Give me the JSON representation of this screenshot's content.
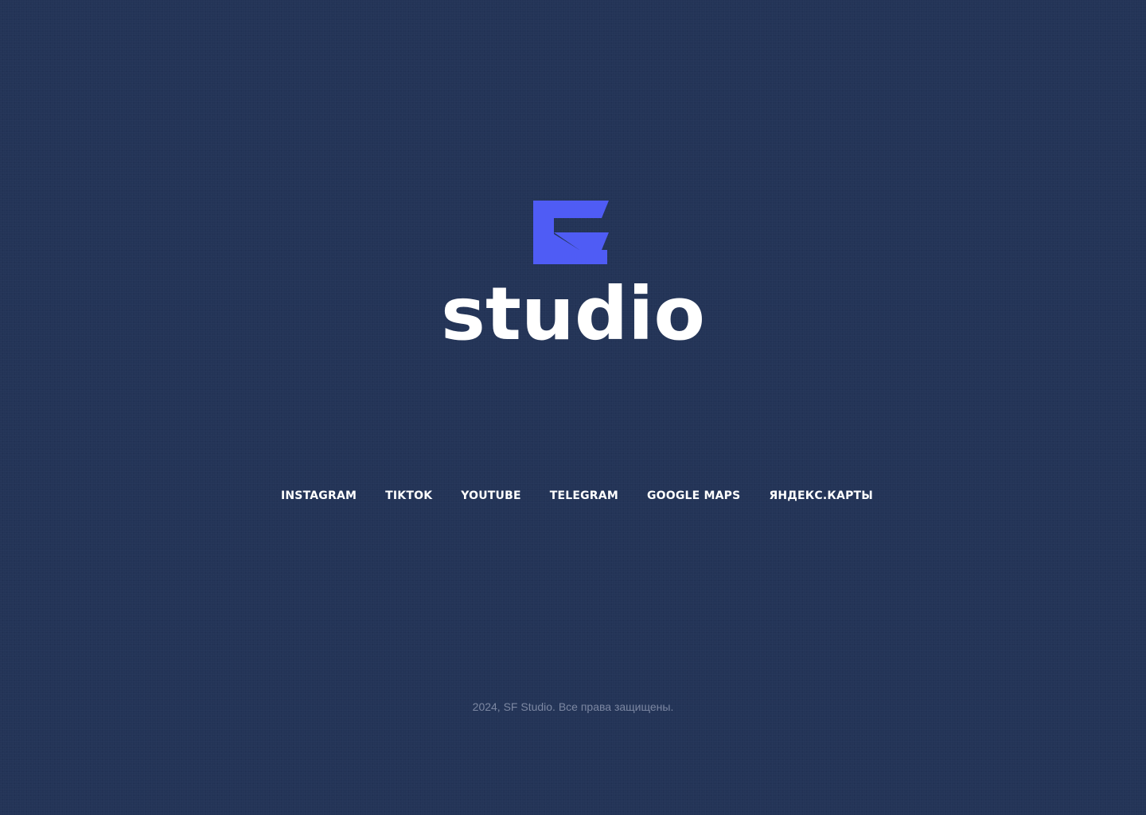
{
  "brand": {
    "name": "studio",
    "accent_color": "#4f5cf5",
    "wordmark_color": "#ffffff",
    "background_color": "#233457"
  },
  "social_links": [
    {
      "label": "INSTAGRAM"
    },
    {
      "label": "TIKTOK"
    },
    {
      "label": "YOUTUBE"
    },
    {
      "label": "TELEGRAM"
    },
    {
      "label": "GOOGLE MAPS"
    },
    {
      "label": "ЯНДЕКС.КАРТЫ"
    }
  ],
  "footer": {
    "copyright": "2024, SF Studio. Все права защищены."
  }
}
